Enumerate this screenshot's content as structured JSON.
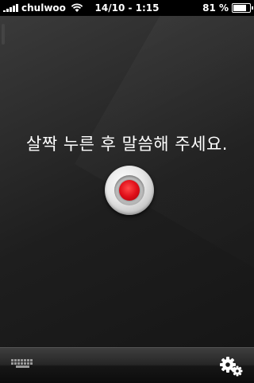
{
  "status_bar": {
    "carrier": "chulwoo",
    "time": "14/10 - 1:15",
    "battery_percent": "81 %",
    "battery_level": 0.81,
    "signal_bars": 5
  },
  "main": {
    "prompt": "살짝 누른 후 말씀해 주세요."
  },
  "record_button": {
    "icon": "record-icon",
    "accent_color": "#e0101a"
  },
  "toolbar": {
    "left_icon": "keyboard-icon",
    "right_icon": "gear-icon"
  }
}
